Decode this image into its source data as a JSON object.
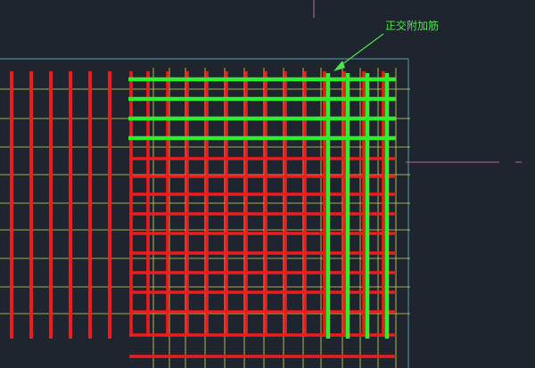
{
  "annotation": {
    "label": "正交附加筋"
  },
  "colors": {
    "background": "#1f252f",
    "rebar_main": "#ee1c1c",
    "rebar_additional": "#2cf02c",
    "grid_line": "#d8d85a",
    "boundary": "#5aa0b4",
    "crosshair": "#b06a9a",
    "annotation": "#4ee44e"
  },
  "drawing": {
    "main_rebar_bars": 34,
    "additional_rebar_bars": 8
  }
}
